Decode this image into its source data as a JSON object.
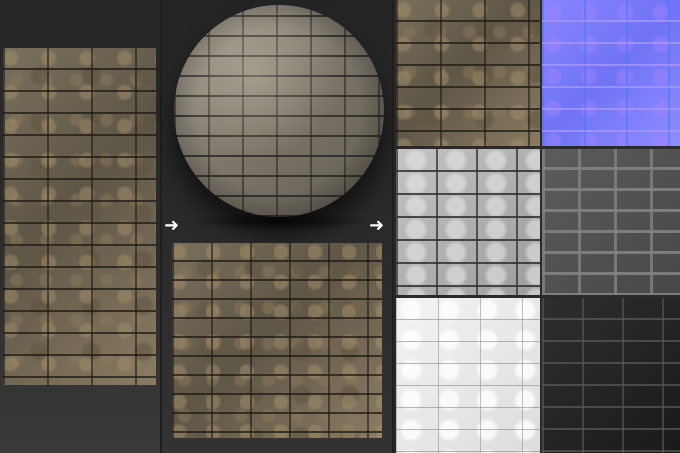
{
  "icons": {
    "arrow_1": "right-arrow-icon",
    "arrow_2": "right-arrow-icon"
  },
  "glyphs": {
    "arrow_1": "➜",
    "arrow_2": "➜"
  },
  "colors": {
    "background": "#1f1f1f",
    "normal_map": "#7a7aff",
    "arrow": "#ffffff"
  }
}
